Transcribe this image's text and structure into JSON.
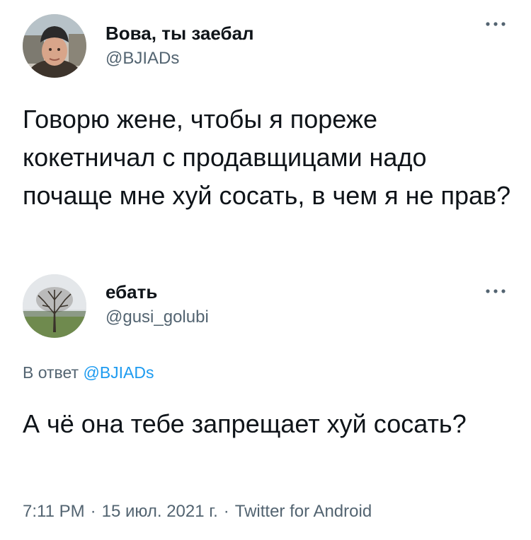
{
  "original_tweet": {
    "display_name": "Вова, ты заебал",
    "handle": "@BJIADs",
    "text": "Говорю жене, чтобы я пореже кокетничал с продавщицами надо почаще мне хуй сосать, в чем я не прав?",
    "avatar_icon": "person-photo-icon",
    "more_icon": "more-dots-icon"
  },
  "reply_tweet": {
    "display_name": "ебать",
    "handle": "@gusi_golubi",
    "replying_to_prefix": "В ответ",
    "replying_to_handle": "@BJIADs",
    "text": "А чё она тебе запрещает хуй сосать?",
    "time": "7:11 PM",
    "date": "15 июл. 2021 г.",
    "source": "Twitter for Android",
    "separator": "·",
    "avatar_icon": "tree-photo-icon",
    "more_icon": "more-dots-icon"
  },
  "colors": {
    "text_primary": "#0f1419",
    "text_secondary": "#536471",
    "link": "#1d9bf0"
  }
}
